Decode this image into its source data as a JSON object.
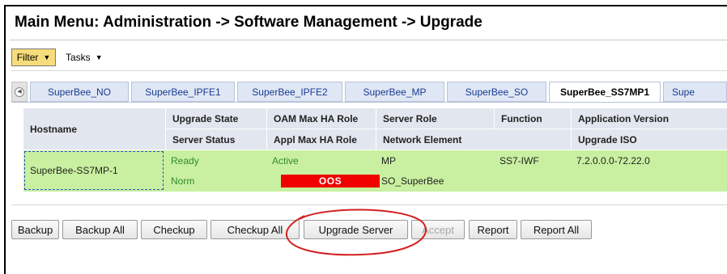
{
  "breadcrumb_title": "Main Menu: Administration -> Software Management -> Upgrade",
  "toolbar": {
    "filter_label": "Filter",
    "tasks_label": "Tasks"
  },
  "tabs": [
    {
      "label": "SuperBee_NO"
    },
    {
      "label": "SuperBee_IPFE1"
    },
    {
      "label": "SuperBee_IPFE2"
    },
    {
      "label": "SuperBee_MP"
    },
    {
      "label": "SuperBee_SO"
    },
    {
      "label": "SuperBee_SS7MP1",
      "active": true
    },
    {
      "label": "Supe"
    }
  ],
  "table": {
    "headers": {
      "hostname": "Hostname",
      "upgrade_state": "Upgrade State",
      "server_status": "Server Status",
      "oam_max_ha_role": "OAM Max HA Role",
      "appl_max_ha_role": "Appl Max HA Role",
      "server_role": "Server Role",
      "network_element": "Network Element",
      "function": "Function",
      "application_version": "Application Version",
      "upgrade_iso": "Upgrade ISO"
    },
    "rows": [
      {
        "hostname": "SuperBee-SS7MP-1",
        "upgrade_state": "Ready",
        "server_status": "Norm",
        "oam_max_ha_role": "Active",
        "appl_max_ha_role": "OOS",
        "server_role": "MP",
        "network_element": "SO_SuperBee",
        "function": "SS7-IWF",
        "application_version": "7.2.0.0.0-72.22.0",
        "upgrade_iso": ""
      }
    ]
  },
  "actions": {
    "backup": "Backup",
    "backup_all": "Backup All",
    "checkup": "Checkup",
    "checkup_all": "Checkup All",
    "upgrade_server": "Upgrade Server",
    "accept": "Accept",
    "report": "Report",
    "report_all": "Report All"
  },
  "colors": {
    "row_highlight": "#c9f0a0",
    "oos_badge": "#f00000",
    "annotation_ellipse": "#d42020",
    "filter_button": "#f6dc7a"
  }
}
